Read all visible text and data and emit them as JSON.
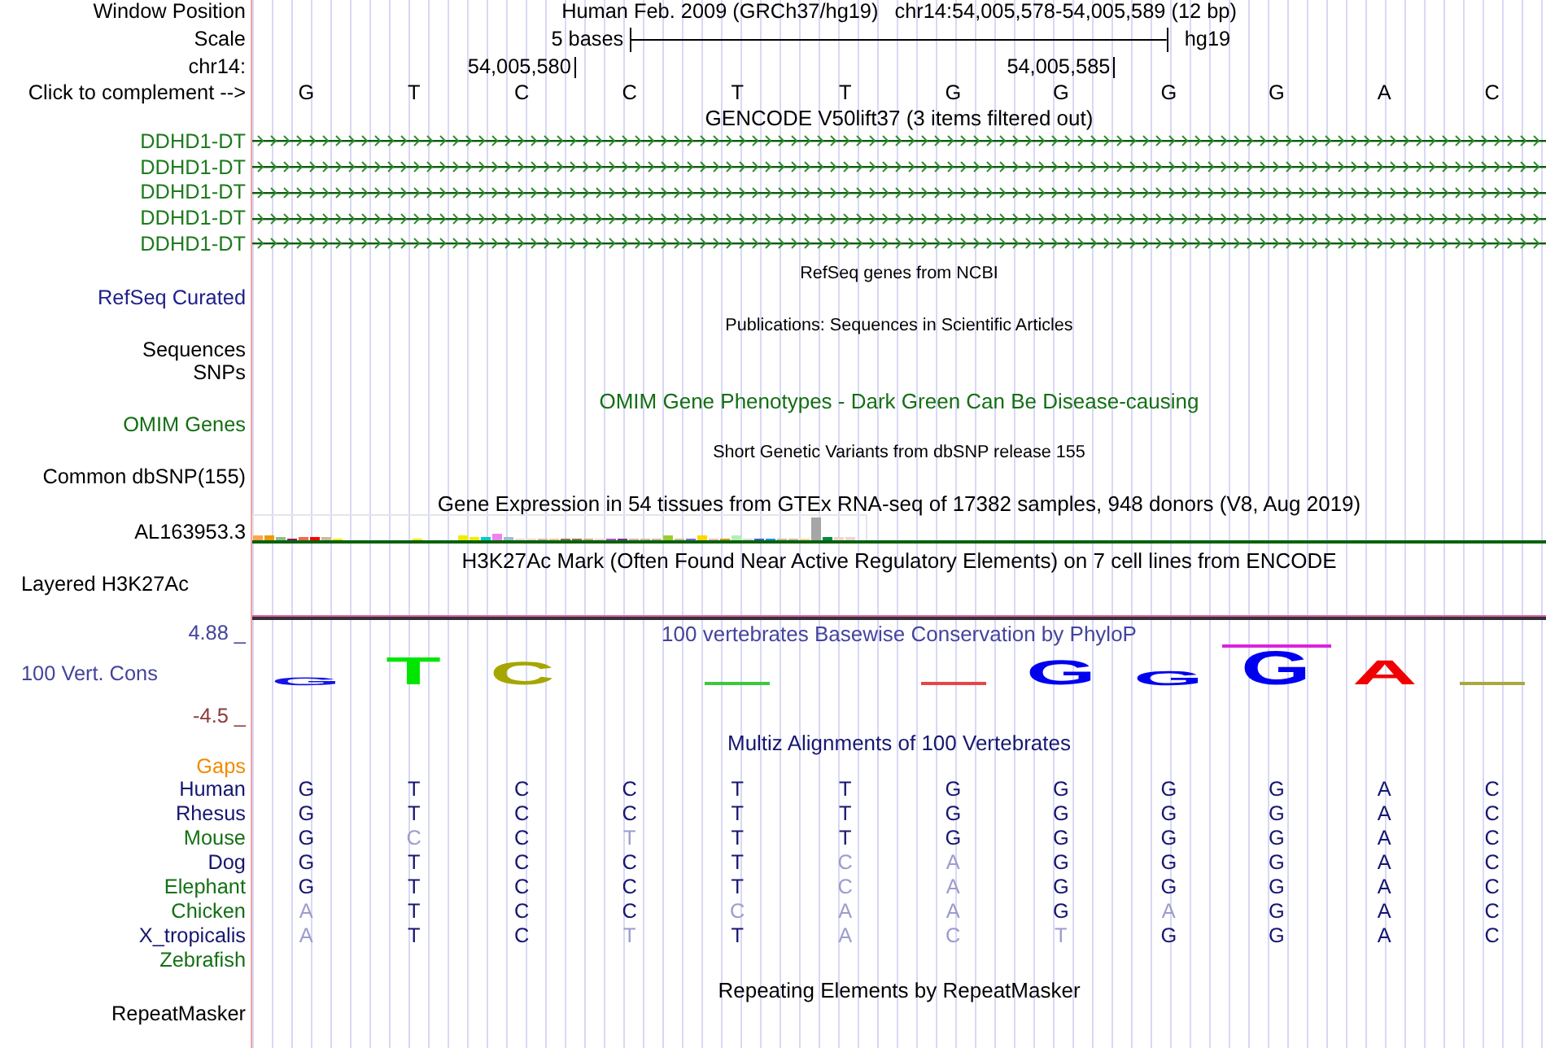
{
  "header": {
    "position_label": "Window Position",
    "assembly": "Human Feb. 2009 (GRCh37/hg19)",
    "position": "chr14:54,005,578-54,005,589 (12 bp)",
    "scale_label": "Scale",
    "scale": "5 bases",
    "scale_db": "hg19",
    "chrom_label": "chr14:",
    "complement_label": "Click to complement -->",
    "bases": [
      {
        "base": "G"
      },
      {
        "base": "T"
      },
      {
        "base": "C",
        "coordinate": "54,005,580"
      },
      {
        "base": "C"
      },
      {
        "base": "T"
      },
      {
        "base": "T"
      },
      {
        "base": "G"
      },
      {
        "base": "G",
        "coordinate": "54,005,585"
      },
      {
        "base": "G"
      },
      {
        "base": "G"
      },
      {
        "base": "A"
      },
      {
        "base": "C"
      }
    ]
  },
  "tracks": [
    {
      "kind": "genes",
      "title": "GENCODE V50lift37 (3 items filtered out)",
      "color": "#000000",
      "items": [
        {
          "label": "DDHD1-DT",
          "color": "#1e7b1e"
        },
        {
          "label": "DDHD1-DT",
          "color": "#1e7b1e"
        },
        {
          "label": "DDHD1-DT",
          "color": "#1e7b1e"
        },
        {
          "label": "DDHD1-DT",
          "color": "#1e7b1e"
        },
        {
          "label": "DDHD1-DT",
          "color": "#1e7b1e"
        }
      ]
    },
    {
      "kind": "group",
      "title": "RefSeq genes from NCBI",
      "color": "#000000",
      "labels": [
        {
          "text": "RefSeq Curated",
          "color": "#20208a"
        }
      ]
    },
    {
      "kind": "group",
      "title": "Publications: Sequences in Scientific Articles",
      "color": "#000000",
      "labels": [
        {
          "text": "Sequences",
          "color": "#000000"
        },
        {
          "text": "SNPs",
          "color": "#000000"
        }
      ]
    },
    {
      "kind": "track",
      "title": "OMIM Gene Phenotypes - Dark Green Can Be Disease-causing",
      "color": "#146e14",
      "labels": [
        {
          "text": "OMIM Genes",
          "color": "#146e14"
        }
      ]
    },
    {
      "kind": "group",
      "title": "Short Genetic Variants from dbSNP release 155",
      "color": "#000000",
      "labels": [
        {
          "text": "Common dbSNP(155)",
          "color": "#000000"
        }
      ]
    },
    {
      "kind": "expression",
      "title": "Gene Expression in 54 tissues from GTEx RNA-seq of 17382 samples, 948 donors (V8, Aug 2019)",
      "color": "#000000",
      "labels": [
        {
          "text": "AL163953.3",
          "color": "#000000"
        }
      ]
    },
    {
      "kind": "signal",
      "title": "H3K27Ac Mark (Often Found Near Active Regulatory Elements) on 7 cell lines from ENCODE",
      "color": "#000000",
      "labels": [
        {
          "text": "Layered H3K27Ac",
          "color": "#000000"
        }
      ]
    },
    {
      "kind": "conservation",
      "title": "100 vertebrates Basewise Conservation by PhyloP",
      "color": "#44449c",
      "max": "4.88 _",
      "min": "-4.5 _",
      "labels": [
        {
          "text": "100 Vert. Cons",
          "color": "#44449c"
        }
      ],
      "logo": [
        {
          "kind": "letter",
          "base": "G",
          "color": "#1414e6",
          "overline": false
        },
        {
          "kind": "letter",
          "base": "T",
          "color": "#00e600",
          "overline": false
        },
        {
          "kind": "letter",
          "base": "C",
          "color": "#a6a600",
          "overline": false
        },
        {
          "kind": "blank"
        },
        {
          "kind": "mark",
          "color": "#3cc83c"
        },
        {
          "kind": "blank"
        },
        {
          "kind": "mark",
          "color": "#e64646"
        },
        {
          "kind": "letter",
          "base": "G",
          "color": "#0000f0",
          "overline": false
        },
        {
          "kind": "letter",
          "base": "G",
          "color": "#0000f0",
          "overline": false
        },
        {
          "kind": "letter",
          "base": "G",
          "color": "#0000f0",
          "overline": true
        },
        {
          "kind": "letter",
          "base": "A",
          "color": "#f00000",
          "overline": false
        },
        {
          "kind": "mark",
          "color": "#a8a840"
        }
      ]
    },
    {
      "kind": "alignment",
      "title": "Multiz Alignments of 100 Vertebrates",
      "color": "#161670",
      "labels": [
        {
          "text": "Gaps",
          "color": "#f08c00"
        }
      ],
      "species": [
        {
          "name": "Human",
          "color": "#161670",
          "bases": [
            {
              "base": "G",
              "match": true
            },
            {
              "base": "T",
              "match": true
            },
            {
              "base": "C",
              "match": true
            },
            {
              "base": "C",
              "match": true
            },
            {
              "base": "T",
              "match": true
            },
            {
              "base": "T",
              "match": true
            },
            {
              "base": "G",
              "match": true
            },
            {
              "base": "G",
              "match": true
            },
            {
              "base": "G",
              "match": true
            },
            {
              "base": "G",
              "match": true
            },
            {
              "base": "A",
              "match": true
            },
            {
              "base": "C",
              "match": true
            }
          ]
        },
        {
          "name": "Rhesus",
          "color": "#161670",
          "bases": [
            {
              "base": "G",
              "match": true
            },
            {
              "base": "T",
              "match": true
            },
            {
              "base": "C",
              "match": true
            },
            {
              "base": "C",
              "match": true
            },
            {
              "base": "T",
              "match": true
            },
            {
              "base": "T",
              "match": true
            },
            {
              "base": "G",
              "match": true
            },
            {
              "base": "G",
              "match": true
            },
            {
              "base": "G",
              "match": true
            },
            {
              "base": "G",
              "match": true
            },
            {
              "base": "A",
              "match": true
            },
            {
              "base": "C",
              "match": true
            }
          ]
        },
        {
          "name": "Mouse",
          "color": "#157015",
          "bases": [
            {
              "base": "G",
              "match": true
            },
            {
              "base": "C",
              "match": false
            },
            {
              "base": "C",
              "match": true
            },
            {
              "base": "T",
              "match": false
            },
            {
              "base": "T",
              "match": true
            },
            {
              "base": "T",
              "match": true
            },
            {
              "base": "G",
              "match": true
            },
            {
              "base": "G",
              "match": true
            },
            {
              "base": "G",
              "match": true
            },
            {
              "base": "G",
              "match": true
            },
            {
              "base": "A",
              "match": true
            },
            {
              "base": "C",
              "match": true
            }
          ]
        },
        {
          "name": "Dog",
          "color": "#161670",
          "bases": [
            {
              "base": "G",
              "match": true
            },
            {
              "base": "T",
              "match": true
            },
            {
              "base": "C",
              "match": true
            },
            {
              "base": "C",
              "match": true
            },
            {
              "base": "T",
              "match": true
            },
            {
              "base": "C",
              "match": false
            },
            {
              "base": "A",
              "match": false
            },
            {
              "base": "G",
              "match": true
            },
            {
              "base": "G",
              "match": true
            },
            {
              "base": "G",
              "match": true
            },
            {
              "base": "A",
              "match": true
            },
            {
              "base": "C",
              "match": true
            }
          ]
        },
        {
          "name": "Elephant",
          "color": "#157015",
          "bases": [
            {
              "base": "G",
              "match": true
            },
            {
              "base": "T",
              "match": true
            },
            {
              "base": "C",
              "match": true
            },
            {
              "base": "C",
              "match": true
            },
            {
              "base": "T",
              "match": true
            },
            {
              "base": "C",
              "match": false
            },
            {
              "base": "A",
              "match": false
            },
            {
              "base": "G",
              "match": true
            },
            {
              "base": "G",
              "match": true
            },
            {
              "base": "G",
              "match": true
            },
            {
              "base": "A",
              "match": true
            },
            {
              "base": "C",
              "match": true
            }
          ]
        },
        {
          "name": "Chicken",
          "color": "#157015",
          "bases": [
            {
              "base": "A",
              "match": false
            },
            {
              "base": "T",
              "match": true
            },
            {
              "base": "C",
              "match": true
            },
            {
              "base": "C",
              "match": true
            },
            {
              "base": "C",
              "match": false
            },
            {
              "base": "A",
              "match": false
            },
            {
              "base": "A",
              "match": false
            },
            {
              "base": "G",
              "match": true
            },
            {
              "base": "A",
              "match": false
            },
            {
              "base": "G",
              "match": true
            },
            {
              "base": "A",
              "match": true
            },
            {
              "base": "C",
              "match": true
            }
          ]
        },
        {
          "name": "X_tropicalis",
          "color": "#161670",
          "bases": [
            {
              "base": "A",
              "match": false
            },
            {
              "base": "T",
              "match": true
            },
            {
              "base": "C",
              "match": true
            },
            {
              "base": "T",
              "match": false
            },
            {
              "base": "T",
              "match": true
            },
            {
              "base": "A",
              "match": false
            },
            {
              "base": "C",
              "match": false
            },
            {
              "base": "T",
              "match": false
            },
            {
              "base": "G",
              "match": true
            },
            {
              "base": "G",
              "match": true
            },
            {
              "base": "A",
              "match": true
            },
            {
              "base": "C",
              "match": true
            }
          ]
        },
        {
          "name": "Zebrafish",
          "color": "#157015"
        }
      ]
    },
    {
      "kind": "track",
      "title": "Repeating Elements by RepeatMasker",
      "color": "#000000",
      "labels": [
        {
          "text": "RepeatMasker",
          "color": "#000000"
        }
      ]
    }
  ]
}
